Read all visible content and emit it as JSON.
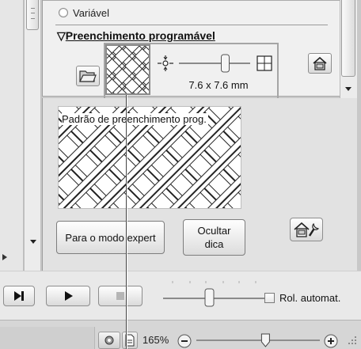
{
  "upper_panel": {
    "radio_option_label": "Variável",
    "section_title": "Preenchimento programável",
    "pattern_size": "7.6 x 7.6 mm",
    "size_slider_level": 0.65
  },
  "lower_panel": {
    "preview_caption": "Padrão de preenchimento prog.",
    "expert_button_label": "Para o modo expert",
    "hide_hint_button_label": "Ocultar\ndica"
  },
  "playback": {
    "speed_slider_level": 0.45,
    "autoscroll_label": "Rol. automat.",
    "autoscroll_checked": false
  },
  "status_bar": {
    "zoom_label": "165%",
    "zoom_slider_level": 0.56
  },
  "icons": {
    "section_toggle": "triangle-down-icon",
    "open": "open-folder-icon",
    "home": "home-icon",
    "settings": "home-settings-icon",
    "step": "step-forward-icon",
    "play": "play-icon",
    "stop": "stop-icon"
  }
}
